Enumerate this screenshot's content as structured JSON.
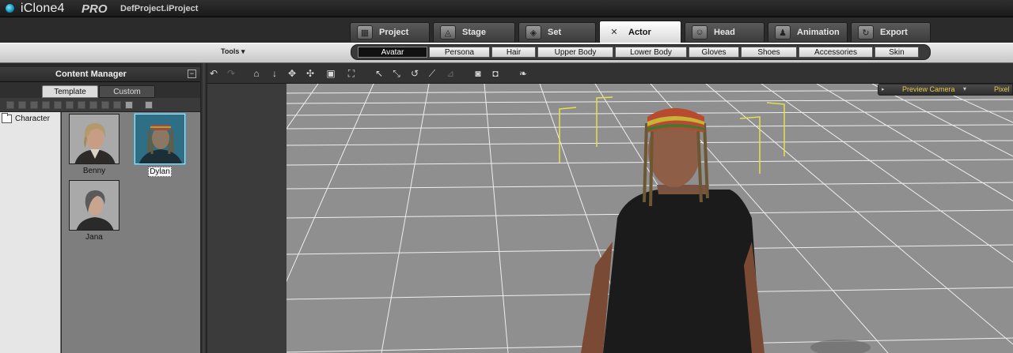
{
  "app": {
    "name": "iClone4",
    "edition": "PRO",
    "project": "DefProject.iProject"
  },
  "main_tabs": [
    {
      "label": "Project",
      "icon": "project-icon"
    },
    {
      "label": "Stage",
      "icon": "stage-icon"
    },
    {
      "label": "Set",
      "icon": "set-icon"
    },
    {
      "label": "Actor",
      "icon": "actor-icon",
      "active": true
    },
    {
      "label": "Head",
      "icon": "head-icon"
    },
    {
      "label": "Animation",
      "icon": "animation-icon"
    },
    {
      "label": "Export",
      "icon": "export-icon"
    }
  ],
  "tools_menu": "Tools ▾",
  "sub_tabs": [
    "Avatar",
    "Persona",
    "Hair",
    "Upper Body",
    "Lower Body",
    "Gloves",
    "Shoes",
    "Accessories",
    "Skin"
  ],
  "content_manager": {
    "title": "Content Manager",
    "collapse": "−",
    "tabs": [
      "Template",
      "Custom"
    ],
    "tree": [
      "Character"
    ],
    "items": [
      {
        "label": "Benny"
      },
      {
        "label": "Dylan",
        "selected": true
      },
      {
        "label": "Jana"
      }
    ]
  },
  "viewport": {
    "camera": "Preview Camera",
    "camera_dropdown": "▾",
    "camera_arrow": "▸",
    "pixel": "Pixel",
    "background_color": "#8f8f8f",
    "grid_color": "#ffffff"
  }
}
